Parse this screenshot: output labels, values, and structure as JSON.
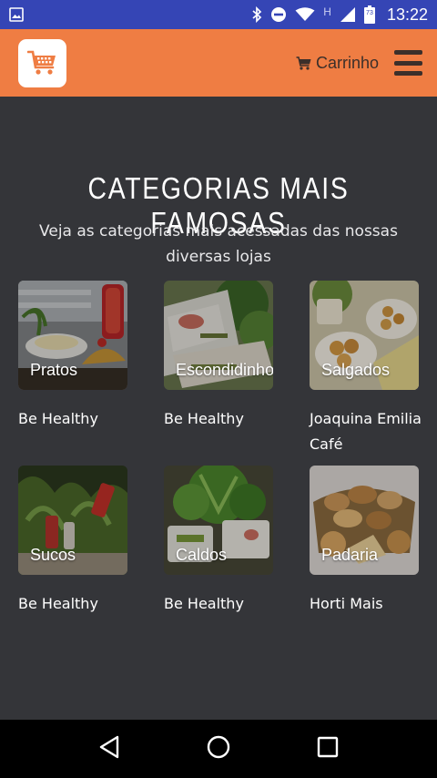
{
  "status_bar": {
    "network_letter": "H",
    "battery_level": "73",
    "time": "13:22"
  },
  "header": {
    "cart_label": "Carrinho"
  },
  "section": {
    "title": "CATEGORIAS MAIS FAMOSAS",
    "subtitle": "Veja as categorias mais acessadas das nossas diversas lojas"
  },
  "categories": [
    {
      "label": "Pratos",
      "store": "Be Healthy"
    },
    {
      "label": "Escondidinhos",
      "store": "Be Healthy"
    },
    {
      "label": "Salgados",
      "store": "Joaquina Emilia Café"
    },
    {
      "label": "Sucos",
      "store": "Be Healthy"
    },
    {
      "label": "Caldos",
      "store": "Be Healthy"
    },
    {
      "label": "Padaria",
      "store": "Horti Mais"
    }
  ],
  "colors": {
    "status_bar": "#3545b5",
    "header": "#ef7d43",
    "background": "#343539"
  }
}
